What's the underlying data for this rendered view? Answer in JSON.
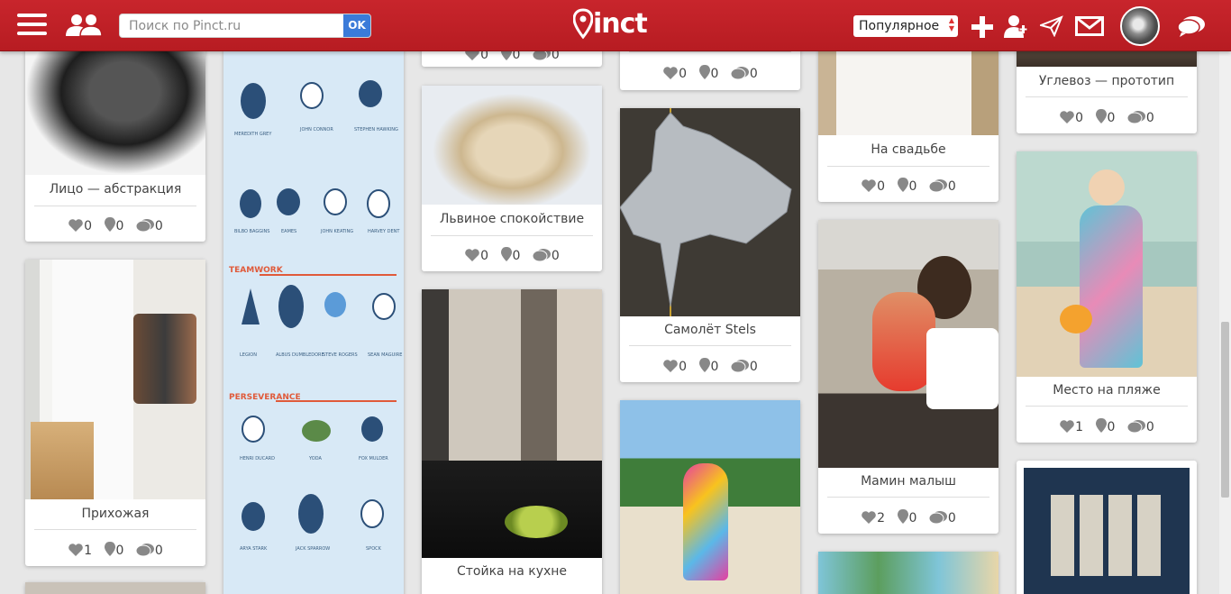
{
  "header": {
    "search_placeholder": "Поиск по Pinct.ru",
    "search_button": "OK",
    "logo": "inct",
    "sort_label": "Популярное"
  },
  "icons": [
    "menu-icon",
    "people-icon",
    "plus-icon",
    "add-user-icon",
    "send-icon",
    "mail-icon",
    "avatar",
    "chat-icon"
  ],
  "pins": [
    {
      "title": "Лицо — абстракция",
      "likes": "0",
      "repins": "0",
      "comments": "0"
    },
    {
      "title": "Прихожая",
      "likes": "1",
      "repins": "0",
      "comments": "0"
    },
    {
      "title": "",
      "likes": "0",
      "repins": "0",
      "comments": "0"
    },
    {
      "title": "Львиное спокойствие",
      "likes": "0",
      "repins": "0",
      "comments": "0"
    },
    {
      "title": "Стойка на кухне",
      "likes": "",
      "repins": "",
      "comments": ""
    },
    {
      "title": "",
      "likes": "0",
      "repins": "0",
      "comments": "0"
    },
    {
      "title": "Самолёт Stels",
      "likes": "0",
      "repins": "0",
      "comments": "0"
    },
    {
      "title": "На свадьбе",
      "likes": "0",
      "repins": "0",
      "comments": "0"
    },
    {
      "title": "Мамин малыш",
      "likes": "2",
      "repins": "0",
      "comments": "0"
    },
    {
      "title": "Углевоз — прототип",
      "likes": "0",
      "repins": "0",
      "comments": "0"
    },
    {
      "title": "Место на пляже",
      "likes": "1",
      "repins": "0",
      "comments": "0"
    }
  ],
  "infographic": {
    "sections": [
      "TEAMWORK",
      "PERSEVERANCE"
    ]
  },
  "colors": {
    "header": "#b71c22",
    "accent": "#3b7bd9",
    "background": "#e7e7e7"
  }
}
